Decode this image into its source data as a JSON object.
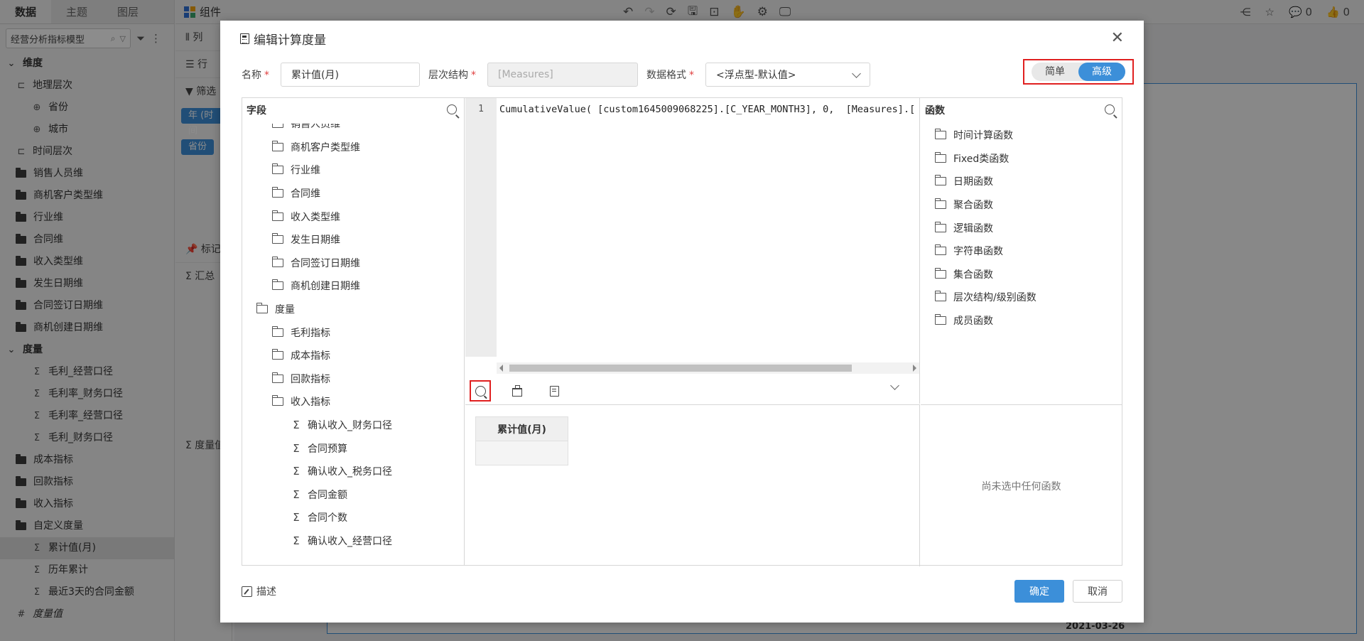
{
  "app": {
    "left_tabs": [
      "数据",
      "主题",
      "图层"
    ],
    "model_select": "经营分析指标模型",
    "tree": [
      {
        "type": "section",
        "label": "维度",
        "icon": "chevron-down-icon"
      },
      {
        "type": "hier",
        "label": "地理层次",
        "indent": 1
      },
      {
        "type": "geo",
        "label": "省份",
        "indent": 2
      },
      {
        "type": "geo",
        "label": "城市",
        "indent": 2
      },
      {
        "type": "hier",
        "label": "时间层次",
        "indent": 1
      },
      {
        "type": "folder",
        "label": "销售人员维",
        "indent": 1
      },
      {
        "type": "folder",
        "label": "商机客户类型维",
        "indent": 1
      },
      {
        "type": "folder",
        "label": "行业维",
        "indent": 1
      },
      {
        "type": "folder",
        "label": "合同维",
        "indent": 1
      },
      {
        "type": "folder",
        "label": "收入类型维",
        "indent": 1
      },
      {
        "type": "folder",
        "label": "发生日期维",
        "indent": 1
      },
      {
        "type": "folder",
        "label": "合同签订日期维",
        "indent": 1
      },
      {
        "type": "folder",
        "label": "商机创建日期维",
        "indent": 1
      },
      {
        "type": "section",
        "label": "度量",
        "icon": "chevron-down-icon"
      },
      {
        "type": "measure",
        "label": "毛利_经营口径",
        "indent": 2
      },
      {
        "type": "measure",
        "label": "毛利率_财务口径",
        "indent": 2
      },
      {
        "type": "measure",
        "label": "毛利率_经营口径",
        "indent": 2
      },
      {
        "type": "measure",
        "label": "毛利_财务口径",
        "indent": 2
      },
      {
        "type": "folder",
        "label": "成本指标",
        "indent": 1
      },
      {
        "type": "folder",
        "label": "回款指标",
        "indent": 1
      },
      {
        "type": "folder",
        "label": "收入指标",
        "indent": 1
      },
      {
        "type": "folder",
        "label": "自定义度量",
        "indent": 1
      },
      {
        "type": "measure",
        "label": "累计值(月)",
        "indent": 2,
        "selected": true
      },
      {
        "type": "measure",
        "label": "历年累计",
        "indent": 2
      },
      {
        "type": "measure",
        "label": "最近3天的合同金额",
        "indent": 2
      },
      {
        "type": "hash",
        "label": "度量值",
        "indent": 1
      }
    ],
    "mid": {
      "col_label": "列",
      "row_label": "行",
      "filter_label": "筛选",
      "pills": [
        "年 (时间",
        "省份"
      ],
      "mark_label": "标记",
      "sum_label": "汇总",
      "measure_label": "度量值"
    },
    "topbar": {
      "component_label": "组件",
      "comments": "0",
      "likes": "0"
    },
    "canvas_date": "2021-03-26"
  },
  "dialog": {
    "title": "编辑计算度量",
    "name_label": "名称",
    "name_value": "累计值(月)",
    "hier_label": "层次结构",
    "hier_placeholder": "[Measures]",
    "format_label": "数据格式",
    "format_value": "<浮点型-默认值>",
    "mode_simple": "简单",
    "mode_advanced": "高级",
    "fields_title": "字段",
    "fields": [
      {
        "level": "l2",
        "kind": "folder",
        "label": "销售人员维"
      },
      {
        "level": "l2",
        "kind": "folder",
        "label": "商机客户类型维"
      },
      {
        "level": "l2",
        "kind": "folder",
        "label": "行业维"
      },
      {
        "level": "l2",
        "kind": "folder",
        "label": "合同维"
      },
      {
        "level": "l2",
        "kind": "folder",
        "label": "收入类型维"
      },
      {
        "level": "l2",
        "kind": "folder",
        "label": "发生日期维"
      },
      {
        "level": "l2",
        "kind": "folder",
        "label": "合同签订日期维"
      },
      {
        "level": "l2",
        "kind": "folder",
        "label": "商机创建日期维"
      },
      {
        "level": "l1",
        "kind": "folder-open",
        "label": "度量"
      },
      {
        "level": "l2",
        "kind": "folder",
        "label": "毛利指标"
      },
      {
        "level": "l2",
        "kind": "folder",
        "label": "成本指标"
      },
      {
        "level": "l2",
        "kind": "folder",
        "label": "回款指标"
      },
      {
        "level": "l2",
        "kind": "folder-open",
        "label": "收入指标"
      },
      {
        "level": "l3",
        "kind": "sigma",
        "label": "确认收入_财务口径"
      },
      {
        "level": "l3",
        "kind": "sigma",
        "label": "合同预算"
      },
      {
        "level": "l3",
        "kind": "sigma",
        "label": "确认收入_税务口径"
      },
      {
        "level": "l3",
        "kind": "sigma",
        "label": "合同金额"
      },
      {
        "level": "l3",
        "kind": "sigma",
        "label": "合同个数"
      },
      {
        "level": "l3",
        "kind": "sigma",
        "label": "确认收入_经营口径"
      }
    ],
    "editor": {
      "line_number": "1",
      "code": "CumulativeValue( [custom1645009068225].[C_YEAR_MONTH3], 0,  [Measures].["
    },
    "functions_title": "函数",
    "functions": [
      "时间计算函数",
      "Fixed类函数",
      "日期函数",
      "聚合函数",
      "逻辑函数",
      "字符串函数",
      "集合函数",
      "层次结构/级别函数",
      "成员函数"
    ],
    "preview_header": "累计值(月)",
    "no_function": "尚未选中任何函数",
    "describe_label": "描述",
    "ok_label": "确定",
    "cancel_label": "取消"
  }
}
